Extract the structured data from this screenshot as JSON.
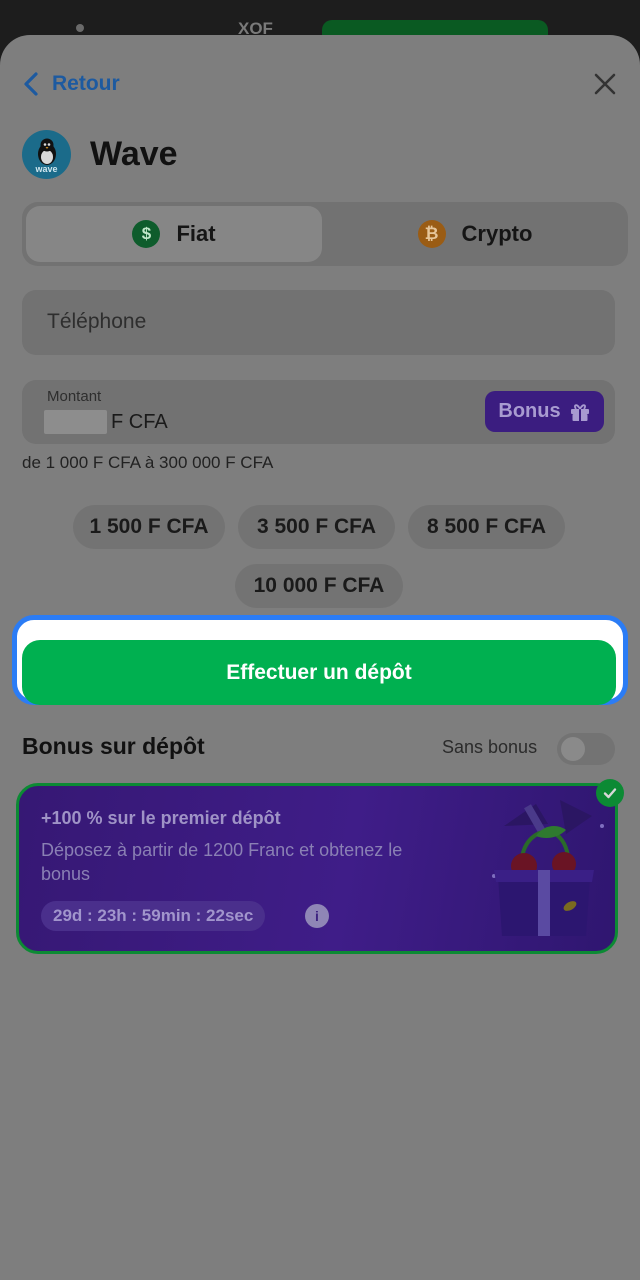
{
  "status": {
    "currency": "XOF"
  },
  "nav": {
    "back_label": "Retour",
    "close": "close-icon"
  },
  "method": {
    "name": "Wave",
    "logo_text": "wave"
  },
  "tabs": [
    {
      "label": "Fiat",
      "icon": "dollar-icon",
      "symbol": "$",
      "active": true
    },
    {
      "label": "Crypto",
      "icon": "bitcoin-icon",
      "symbol": "₿",
      "active": false
    }
  ],
  "phone": {
    "placeholder": "Téléphone"
  },
  "amount": {
    "label": "Montant",
    "currency": "F CFA",
    "bonus_label": "Bonus"
  },
  "range_text": "de 1 000 F CFA à 300 000 F CFA",
  "presets": [
    "1 500 F CFA",
    "3 500 F CFA",
    "8 500 F CFA",
    "10 000 F CFA"
  ],
  "cta_label": "Effectuer un dépôt",
  "bonus_section": {
    "title": "Bonus sur dépôt",
    "toggle_label": "Sans bonus"
  },
  "offer": {
    "title": "+100 % sur le premier dépôt",
    "description": "Déposez à partir de 1200 Franc et obtenez le bonus",
    "timer": "29d : 23h : 59min : 22sec",
    "info_symbol": "i"
  },
  "colors": {
    "accent_green": "#00b050",
    "focus_blue": "#2b7cf5",
    "offer_purple": "#3f1d88",
    "link_blue": "#1d5aa0"
  }
}
